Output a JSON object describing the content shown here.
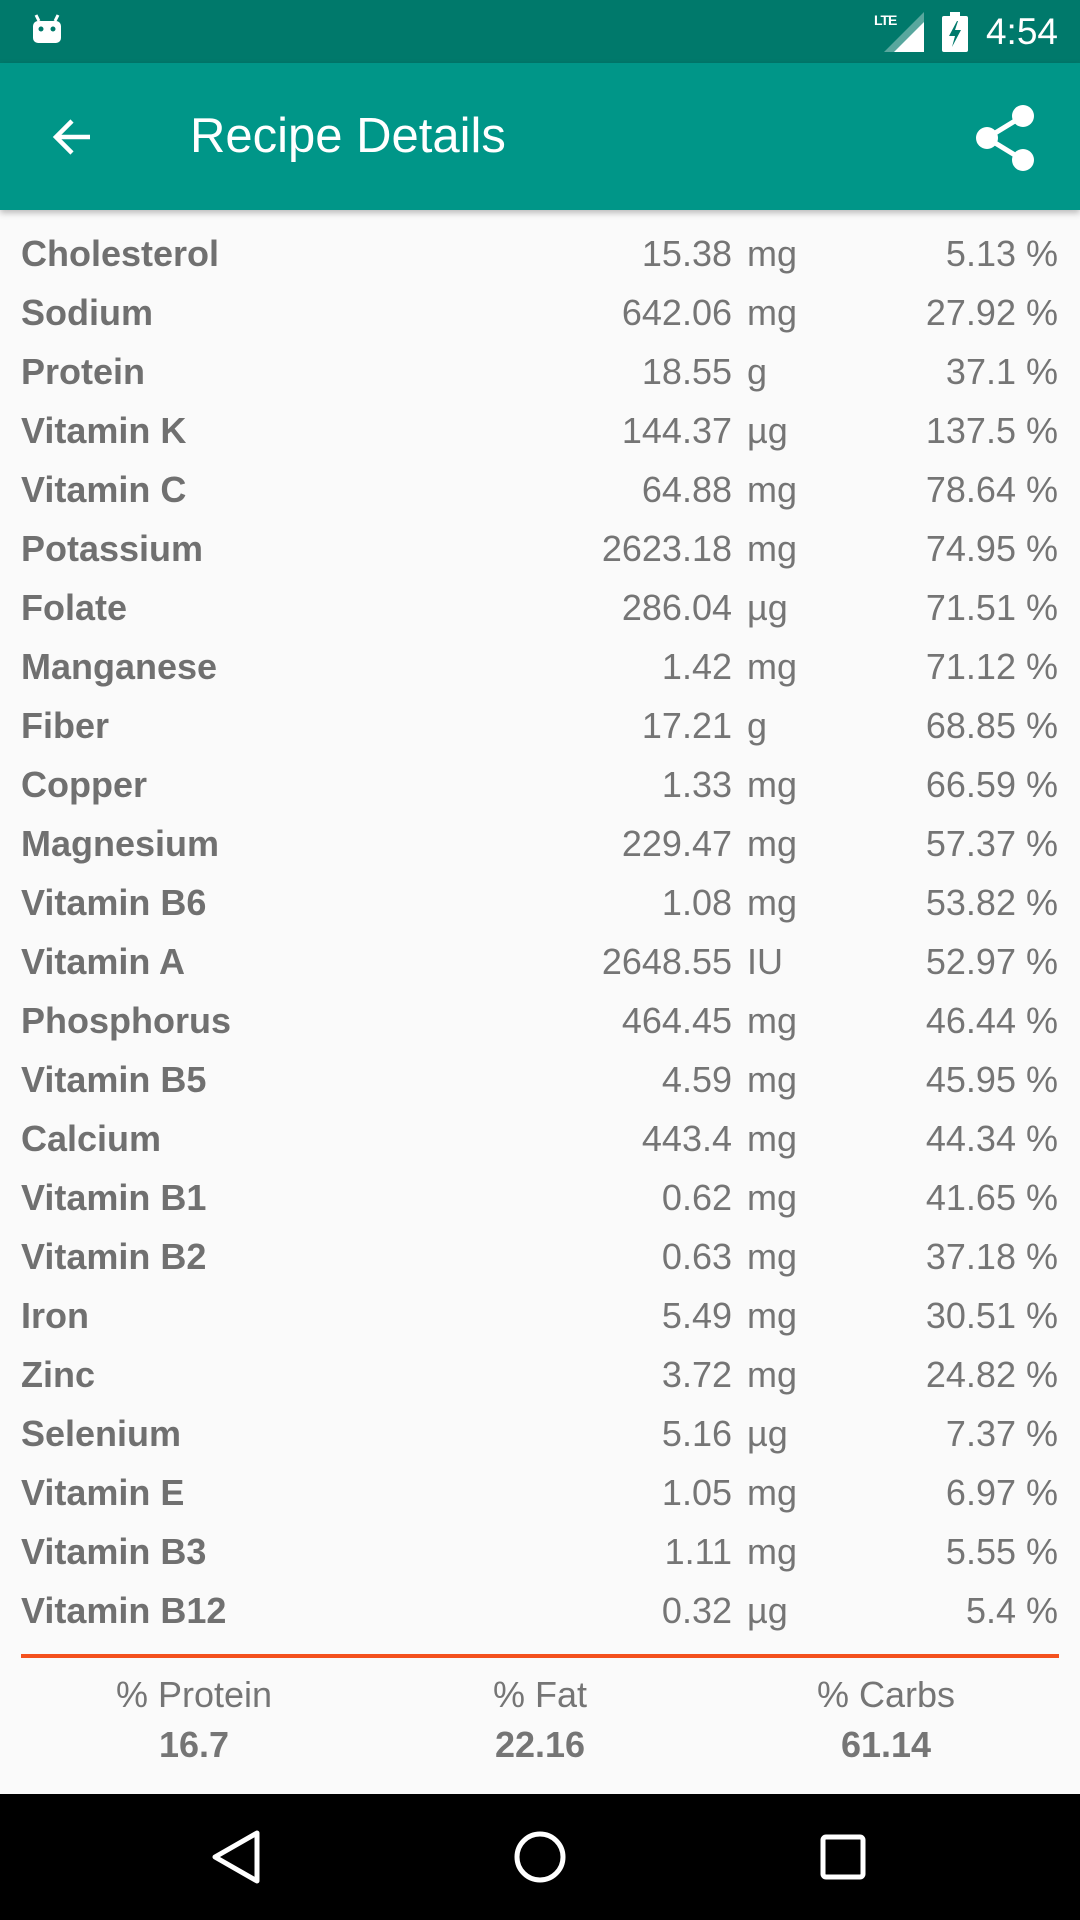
{
  "status_bar": {
    "network": "LTE",
    "time": "4:54"
  },
  "app_bar": {
    "title": "Recipe Details"
  },
  "icons": {
    "status_left": "android-icon",
    "signal": "signal-icon",
    "battery": "battery-charging-icon",
    "back": "arrow-back-icon",
    "share": "share-icon",
    "nav_back": "nav-back-icon",
    "nav_home": "nav-home-icon",
    "nav_recents": "nav-recents-icon"
  },
  "colors": {
    "status_bar": "#00796b",
    "app_bar": "#009688",
    "divider": "#f4511e",
    "text": "#757575"
  },
  "nutrients": [
    {
      "name": "Cholesterol",
      "amount": "15.38",
      "unit": "mg",
      "percent": "5.13 %"
    },
    {
      "name": "Sodium",
      "amount": "642.06",
      "unit": "mg",
      "percent": "27.92 %"
    },
    {
      "name": "Protein",
      "amount": "18.55",
      "unit": "g",
      "percent": "37.1 %"
    },
    {
      "name": "Vitamin K",
      "amount": "144.37",
      "unit": "µg",
      "percent": "137.5 %"
    },
    {
      "name": "Vitamin C",
      "amount": "64.88",
      "unit": "mg",
      "percent": "78.64 %"
    },
    {
      "name": "Potassium",
      "amount": "2623.18",
      "unit": "mg",
      "percent": "74.95 %"
    },
    {
      "name": "Folate",
      "amount": "286.04",
      "unit": "µg",
      "percent": "71.51 %"
    },
    {
      "name": "Manganese",
      "amount": "1.42",
      "unit": "mg",
      "percent": "71.12 %"
    },
    {
      "name": "Fiber",
      "amount": "17.21",
      "unit": "g",
      "percent": "68.85 %"
    },
    {
      "name": "Copper",
      "amount": "1.33",
      "unit": "mg",
      "percent": "66.59 %"
    },
    {
      "name": "Magnesium",
      "amount": "229.47",
      "unit": "mg",
      "percent": "57.37 %"
    },
    {
      "name": "Vitamin B6",
      "amount": "1.08",
      "unit": "mg",
      "percent": "53.82 %"
    },
    {
      "name": "Vitamin A",
      "amount": "2648.55",
      "unit": "IU",
      "percent": "52.97 %"
    },
    {
      "name": "Phosphorus",
      "amount": "464.45",
      "unit": "mg",
      "percent": "46.44 %"
    },
    {
      "name": "Vitamin B5",
      "amount": "4.59",
      "unit": "mg",
      "percent": "45.95 %"
    },
    {
      "name": "Calcium",
      "amount": "443.4",
      "unit": "mg",
      "percent": "44.34 %"
    },
    {
      "name": "Vitamin B1",
      "amount": "0.62",
      "unit": "mg",
      "percent": "41.65 %"
    },
    {
      "name": "Vitamin B2",
      "amount": "0.63",
      "unit": "mg",
      "percent": "37.18 %"
    },
    {
      "name": "Iron",
      "amount": "5.49",
      "unit": "mg",
      "percent": "30.51 %"
    },
    {
      "name": "Zinc",
      "amount": "3.72",
      "unit": "mg",
      "percent": "24.82 %"
    },
    {
      "name": "Selenium",
      "amount": "5.16",
      "unit": "µg",
      "percent": "7.37 %"
    },
    {
      "name": "Vitamin E",
      "amount": "1.05",
      "unit": "mg",
      "percent": "6.97 %"
    },
    {
      "name": "Vitamin B3",
      "amount": "1.11",
      "unit": "mg",
      "percent": "5.55 %"
    },
    {
      "name": "Vitamin B12",
      "amount": "0.32",
      "unit": "µg",
      "percent": "5.4 %"
    }
  ],
  "macros": [
    {
      "label": "% Protein",
      "value": "16.7"
    },
    {
      "label": "% Fat",
      "value": "22.16"
    },
    {
      "label": "% Carbs",
      "value": "61.14"
    }
  ]
}
